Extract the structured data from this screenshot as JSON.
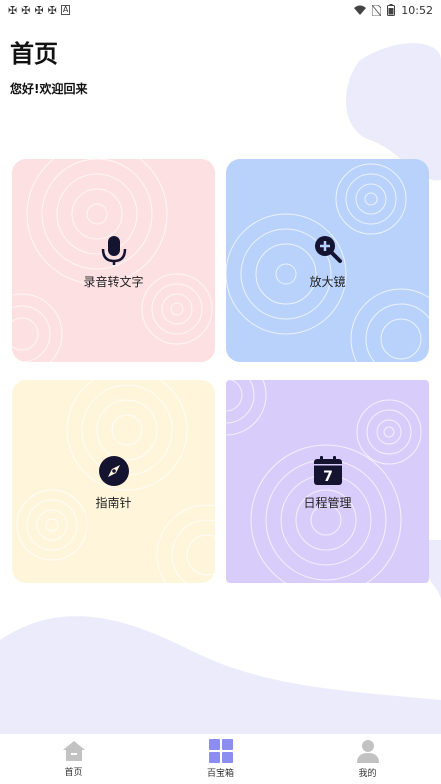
{
  "status_bar": {
    "left_icons": [
      "bug-icon",
      "bug-icon",
      "bug-icon",
      "bug-icon",
      "a-icon"
    ],
    "time": "10:52"
  },
  "header": {
    "title": "首页",
    "greeting": "您好!欢迎回来"
  },
  "cards": [
    {
      "label": "录音转文字",
      "icon": "microphone-icon",
      "color": "#fde0e2"
    },
    {
      "label": "放大镜",
      "icon": "zoom-in-icon",
      "color": "#b9d2fb"
    },
    {
      "label": "指南针",
      "icon": "compass-icon",
      "color": "#fef5db"
    },
    {
      "label": "日程管理",
      "icon": "calendar-icon",
      "color": "#d8cdfa",
      "badge": "7"
    }
  ],
  "bottom_nav": [
    {
      "label": "首页",
      "icon": "home-icon"
    },
    {
      "label": "百宝箱",
      "icon": "grid-icon",
      "active": true
    },
    {
      "label": "我的",
      "icon": "user-icon"
    }
  ],
  "colors": {
    "nav_inactive": "#c2c2c2",
    "nav_active": "#8b8ef0",
    "blob": "#ebebfb"
  }
}
